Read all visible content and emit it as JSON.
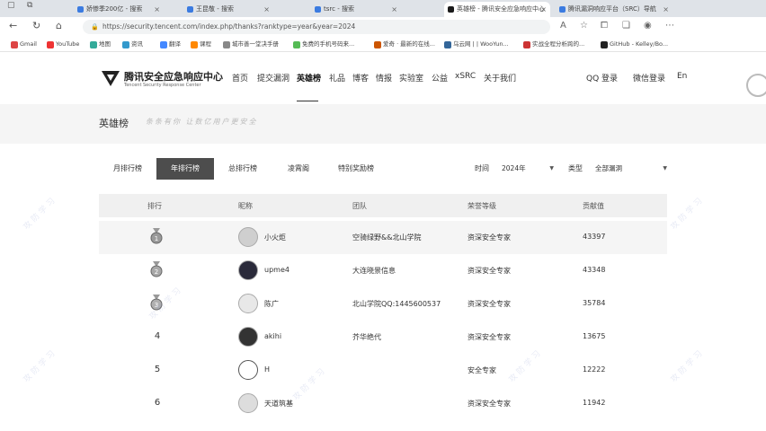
{
  "browser": {
    "tabs": [
      {
        "label": "娇惨季200亿 - 搜索",
        "active": false
      },
      {
        "label": "王昆敬 - 搜索",
        "active": false
      },
      {
        "label": "tsrc - 搜索",
        "active": false
      },
      {
        "label": "英雄榜 - 腾讯安全应急响应中心",
        "active": true
      },
      {
        "label": "腾讯漏洞响应平台（SRC）导航",
        "active": false
      }
    ],
    "url": "https://security.tencent.com/index.php/thanks?ranktype=year&year=2024",
    "bookmarks": [
      "Gmail",
      "YouTube",
      "地图",
      "资讯",
      "翻译",
      "课程",
      "城市善一堂决手册",
      "免费的手机号码来...",
      "爱奇 · 最新的在线...",
      "乌云网 | | WooYun...",
      "实战全程分析跨的...",
      "GitHub - Kelley/Bo..."
    ]
  },
  "site": {
    "logo_cn": "腾讯安全应急响应中心",
    "logo_en": "Tencent Security Response Center",
    "nav": [
      "首页",
      "提交漏洞",
      "英雄榜",
      "礼品",
      "博客",
      "情报",
      "实验室",
      "公益",
      "xSRC",
      "关于我们"
    ],
    "nav_active": "英雄榜",
    "qq_login": "QQ 登录",
    "wechat_login": "微信登录",
    "lang": "En"
  },
  "banner": {
    "title": "英雄榜",
    "slogan": "条条有你 让数亿用户更安全"
  },
  "filters": {
    "tabs": [
      "月排行榜",
      "年排行榜",
      "总排行榜",
      "凌霄阁",
      "特别奖励榜"
    ],
    "active_tab": "年排行榜",
    "time_label": "时间",
    "time_value": "2024年",
    "type_label": "类型",
    "type_value": "全部漏洞"
  },
  "table": {
    "headers": [
      "排行",
      "昵称",
      "团队",
      "荣誉等级",
      "贡献值"
    ],
    "rows": [
      {
        "rank": "1",
        "medal": "gold",
        "nickname": "小火炬",
        "team": "空骑绿野&&北山学院",
        "level": "资深安全专家",
        "score": "43397"
      },
      {
        "rank": "2",
        "medal": "silver",
        "nickname": "upme4",
        "team": "大连晓景信息",
        "level": "资深安全专家",
        "score": "43348"
      },
      {
        "rank": "3",
        "medal": "bronze",
        "nickname": "陈广",
        "team": "北山学院QQ:1445600537",
        "level": "资深安全专家",
        "score": "35784"
      },
      {
        "rank": "4",
        "medal": "",
        "nickname": "akihi",
        "team": "芥华绝代",
        "level": "资深安全专家",
        "score": "13675"
      },
      {
        "rank": "5",
        "medal": "",
        "nickname": "H",
        "team": "",
        "level": "安全专家",
        "score": "12222"
      },
      {
        "rank": "6",
        "medal": "",
        "nickname": "天道筑基",
        "team": "",
        "level": "资深安全专家",
        "score": "11942"
      }
    ]
  },
  "watermark": "攻防学习"
}
